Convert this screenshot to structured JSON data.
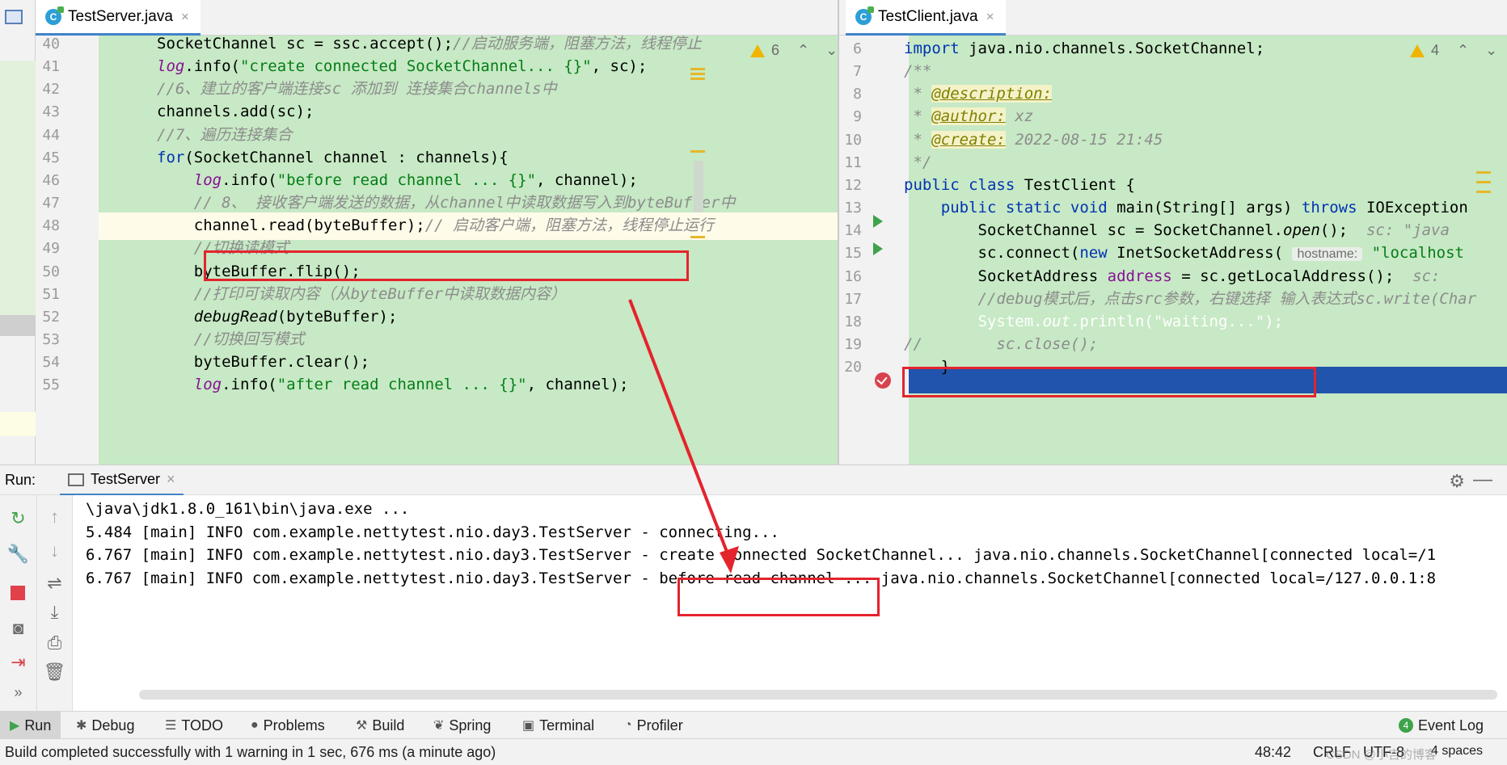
{
  "editor_left": {
    "tab": {
      "icon": "java-class-icon",
      "title": "TestServer.java",
      "close": "×"
    },
    "warnings": {
      "count": "6"
    },
    "lines": [
      {
        "n": "40",
        "segs": [
          [
            "",
            "SocketChannel sc = ssc.accept();"
          ],
          [
            "cm",
            "//启动服务端，阻塞方法，线程停止"
          ]
        ]
      },
      {
        "n": "41",
        "segs": [
          [
            "fld",
            "log"
          ],
          [
            "",
            ".info("
          ],
          [
            "st",
            "\"create connected SocketChannel... {}\""
          ],
          [
            "",
            ", sc);"
          ]
        ]
      },
      {
        "n": "42",
        "segs": [
          [
            "cm",
            "//6、建立的客户端连接sc 添加到 连接集合channels中"
          ]
        ]
      },
      {
        "n": "43",
        "segs": [
          [
            "",
            "channels.add(sc);"
          ]
        ]
      },
      {
        "n": "44",
        "segs": [
          [
            "cm",
            "//7、遍历连接集合"
          ]
        ]
      },
      {
        "n": "45",
        "segs": [
          [
            "kw",
            "for"
          ],
          [
            "",
            "(SocketChannel channel : channels){"
          ]
        ]
      },
      {
        "n": "46",
        "segs": [
          [
            "",
            "    "
          ],
          [
            "fld",
            "log"
          ],
          [
            "",
            ".info("
          ],
          [
            "st",
            "\"before read channel ... {}\""
          ],
          [
            "",
            ", channel);"
          ]
        ]
      },
      {
        "n": "47",
        "segs": [
          [
            "",
            "    "
          ],
          [
            "cm",
            "// 8、 接收客户端发送的数据，从channel中读取数据写入到byteBuffer中"
          ]
        ]
      },
      {
        "n": "48",
        "segs": [
          [
            "",
            "    channel.read(byteBuffer);"
          ],
          [
            "cm",
            "// 启动客户端，阻塞方法，线程停止运行"
          ]
        ]
      },
      {
        "n": "49",
        "segs": [
          [
            "",
            "    "
          ],
          [
            "cm",
            "//切换读模式"
          ]
        ]
      },
      {
        "n": "50",
        "segs": [
          [
            "",
            "    byteBuffer.flip();"
          ]
        ]
      },
      {
        "n": "51",
        "segs": [
          [
            "",
            "    "
          ],
          [
            "cm",
            "//打印可读取内容（从byteBuffer中读取数据内容）"
          ]
        ]
      },
      {
        "n": "52",
        "segs": [
          [
            "",
            "    "
          ],
          [
            "it",
            "debugRead"
          ],
          [
            "",
            "(byteBuffer);"
          ]
        ]
      },
      {
        "n": "53",
        "segs": [
          [
            "",
            "    "
          ],
          [
            "cm",
            "//切换回写模式"
          ]
        ]
      },
      {
        "n": "54",
        "segs": [
          [
            "",
            "    byteBuffer.clear();"
          ]
        ]
      },
      {
        "n": "55",
        "segs": [
          [
            "",
            "    "
          ],
          [
            "fld",
            "log"
          ],
          [
            "",
            ".info("
          ],
          [
            "st",
            "\"after read channel ... {}\""
          ],
          [
            "",
            ", channel);"
          ]
        ]
      }
    ]
  },
  "editor_right": {
    "tab": {
      "icon": "java-class-icon",
      "title": "TestClient.java",
      "close": "×"
    },
    "warnings": {
      "count": "4"
    },
    "lines": [
      {
        "n": "6",
        "segs": [
          [
            "kw",
            "import"
          ],
          [
            "",
            " java.nio.channels.SocketChannel;"
          ]
        ]
      },
      {
        "n": "7",
        "segs": [
          [
            "cm",
            "/**"
          ]
        ]
      },
      {
        "n": "8",
        "segs": [
          [
            "cm",
            " * "
          ],
          [
            "tag",
            "@description:"
          ]
        ]
      },
      {
        "n": "9",
        "segs": [
          [
            "cm",
            " * "
          ],
          [
            "tag",
            "@author:"
          ],
          [
            "cm",
            " xz"
          ]
        ]
      },
      {
        "n": "10",
        "segs": [
          [
            "cm",
            " * "
          ],
          [
            "tag",
            "@create:"
          ],
          [
            "cm",
            " 2022-08-15 21:45"
          ]
        ]
      },
      {
        "n": "11",
        "segs": [
          [
            "cm",
            " */"
          ]
        ]
      },
      {
        "n": "12",
        "segs": [
          [
            "kw",
            "public class"
          ],
          [
            "",
            " TestClient {"
          ]
        ]
      },
      {
        "n": "13",
        "segs": [
          [
            "",
            "    "
          ],
          [
            "kw",
            "public static void"
          ],
          [
            "",
            " main(String[] args) "
          ],
          [
            "kw",
            "throws"
          ],
          [
            "",
            " IOException"
          ]
        ]
      },
      {
        "n": "14",
        "segs": [
          [
            "",
            "        SocketChannel sc = SocketChannel."
          ],
          [
            "it",
            "open"
          ],
          [
            "",
            "();  "
          ],
          [
            "hint",
            "sc: \"java"
          ]
        ]
      },
      {
        "n": "15",
        "segs": [
          [
            "",
            "        sc.connect("
          ],
          [
            "kw",
            "new"
          ],
          [
            "",
            " InetSocketAddress( "
          ],
          [
            "inlay",
            "hostname:"
          ],
          [
            "st",
            " \"localhost"
          ]
        ]
      },
      {
        "n": "16",
        "segs": [
          [
            "",
            "        SocketAddress "
          ],
          [
            "fld2",
            "address"
          ],
          [
            "",
            " = sc.getLocalAddress();  "
          ],
          [
            "hint",
            "sc:"
          ]
        ]
      },
      {
        "n": "17",
        "segs": [
          [
            "",
            "        "
          ],
          [
            "cm",
            "//debug模式后，点击src参数，右键选择 输入表达式sc.write(Char"
          ]
        ]
      },
      {
        "n": "18",
        "segs": [
          [
            "wh",
            "        System."
          ],
          [
            "whi",
            "out"
          ],
          [
            "wh",
            ".println(\"waiting...\");"
          ]
        ]
      },
      {
        "n": "19",
        "segs": [
          [
            "cm",
            "//        sc.close();"
          ]
        ]
      },
      {
        "n": "20",
        "segs": [
          [
            "",
            "    }"
          ]
        ]
      }
    ]
  },
  "run": {
    "label": "Run:",
    "tab_title": "TestServer",
    "tab_close": "×",
    "console_lines": [
      "\\java\\jdk1.8.0_161\\bin\\java.exe ...",
      "5.484 [main] INFO com.example.nettytest.nio.day3.TestServer - connecting...",
      "6.767 [main] INFO com.example.nettytest.nio.day3.TestServer - create connected SocketChannel... java.nio.channels.SocketChannel[connected local=/1",
      "6.767 [main] INFO com.example.nettytest.nio.day3.TestServer - before read channel ... java.nio.channels.SocketChannel[connected local=/127.0.0.1:8"
    ],
    "icons": [
      "rerun-icon",
      "wrench-icon",
      "stop-icon",
      "camera-icon",
      "login-icon",
      "more-icon",
      "up-arrow-icon",
      "down-arrow-icon",
      "soft-wrap-icon",
      "scroll-to-end-icon",
      "print-icon",
      "trash-icon"
    ]
  },
  "tool_windows": [
    {
      "icon": "run-icon",
      "label": "Run"
    },
    {
      "icon": "debug-icon",
      "label": "Debug"
    },
    {
      "icon": "todo-icon",
      "label": "TODO"
    },
    {
      "icon": "problems-icon",
      "label": "Problems"
    },
    {
      "icon": "build-icon",
      "label": "Build"
    },
    {
      "icon": "spring-icon",
      "label": "Spring"
    },
    {
      "icon": "terminal-icon",
      "label": "Terminal"
    },
    {
      "icon": "profiler-icon",
      "label": "Profiler"
    }
  ],
  "event_log": {
    "count": "4",
    "label": "Event Log"
  },
  "status": {
    "message": "Build completed successfully with 1 warning in 1 sec, 676 ms (a minute ago)",
    "position": "48:42",
    "line_sep": "CRLF",
    "encoding": "UTF-8",
    "indent": "4 spaces",
    "watermark": "CSDN @小吉的博客"
  },
  "colors": {
    "code_bg": "#c7e9c5",
    "exec_line": "#2154ad",
    "annotation_red": "#e4242d",
    "keyword": "#0033b3",
    "string": "#067d17"
  }
}
